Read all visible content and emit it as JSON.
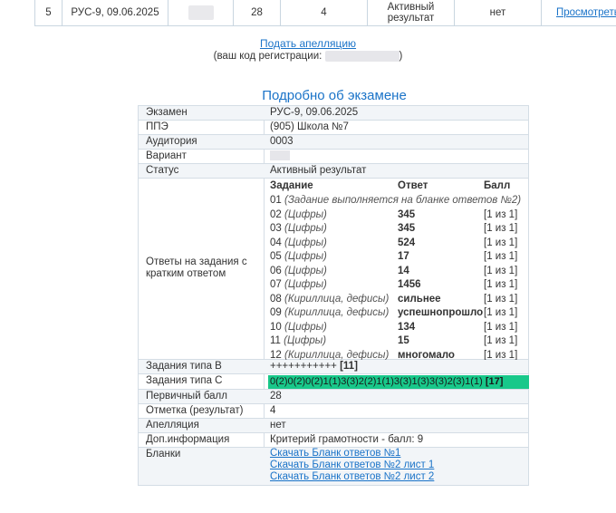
{
  "summary_row": {
    "index": "5",
    "exam": "РУС-9, 09.06.2025",
    "score": "28",
    "mark": "4",
    "status": "Активный результат",
    "appeal": "нет",
    "view_link": "Просмотреть"
  },
  "appeal": {
    "link": "Подать апелляцию",
    "code_prefix": "(ваш код регистрации:",
    "code_suffix": ")"
  },
  "details": {
    "title": "Подробно об экзамене",
    "rows": {
      "exam": {
        "label": "Экзамен",
        "value": "РУС-9, 09.06.2025"
      },
      "ppe": {
        "label": "ППЭ",
        "value": "(905) Школа №7"
      },
      "room": {
        "label": "Аудитория",
        "value": "0003"
      },
      "variant": {
        "label": "Вариант",
        "value": ""
      },
      "status": {
        "label": "Статус",
        "value": "Активный результат"
      }
    },
    "short_answers": {
      "label": "Ответы на задания с кратким ответом",
      "headers": {
        "task": "Задание",
        "answer": "Ответ",
        "score": "Балл"
      },
      "items": [
        {
          "num": "01",
          "type": "(Задание выполняется на бланке ответов №2)",
          "answer": "",
          "score": ""
        },
        {
          "num": "02",
          "type": "(Цифры)",
          "answer": "345",
          "score": "[1 из 1]"
        },
        {
          "num": "03",
          "type": "(Цифры)",
          "answer": "345",
          "score": "[1 из 1]"
        },
        {
          "num": "04",
          "type": "(Цифры)",
          "answer": "524",
          "score": "[1 из 1]"
        },
        {
          "num": "05",
          "type": "(Цифры)",
          "answer": "17",
          "score": "[1 из 1]"
        },
        {
          "num": "06",
          "type": "(Цифры)",
          "answer": "14",
          "score": "[1 из 1]"
        },
        {
          "num": "07",
          "type": "(Цифры)",
          "answer": "1456",
          "score": "[1 из 1]"
        },
        {
          "num": "08",
          "type": "(Кириллица, дефисы)",
          "answer": "сильнее",
          "score": "[1 из 1]"
        },
        {
          "num": "09",
          "type": "(Кириллица, дефисы)",
          "answer": "успешнопрошло",
          "score": "[1 из 1]"
        },
        {
          "num": "10",
          "type": "(Цифры)",
          "answer": "134",
          "score": "[1 из 1]"
        },
        {
          "num": "11",
          "type": "(Цифры)",
          "answer": "15",
          "score": "[1 из 1]"
        },
        {
          "num": "12",
          "type": "(Кириллица, дефисы)",
          "answer": "многомало",
          "score": "[1 из 1]"
        }
      ]
    },
    "type_b": {
      "label": "Задания типа B",
      "marks": "+++++++++++",
      "total": "[11]"
    },
    "type_c": {
      "label": "Задания типа C",
      "marks": "0(2)0(2)0(2)1(1)3(3)2(2)1(1)3(3)1(3)3(3)2(3)1(1)",
      "total": "[17]"
    },
    "primary": {
      "label": "Первичный балл",
      "value": "28"
    },
    "mark": {
      "label": "Отметка (результат)",
      "value": "4"
    },
    "appeal": {
      "label": "Апелляция",
      "value": "нет"
    },
    "extra": {
      "label": "Доп.информация",
      "value": "Критерий грамотности - балл: 9"
    },
    "forms": {
      "label": "Бланки",
      "links": [
        "Скачать Бланк ответов №1",
        "Скачать Бланк ответов №2 лист 1",
        "Скачать Бланк ответов №2 лист 2"
      ]
    }
  }
}
